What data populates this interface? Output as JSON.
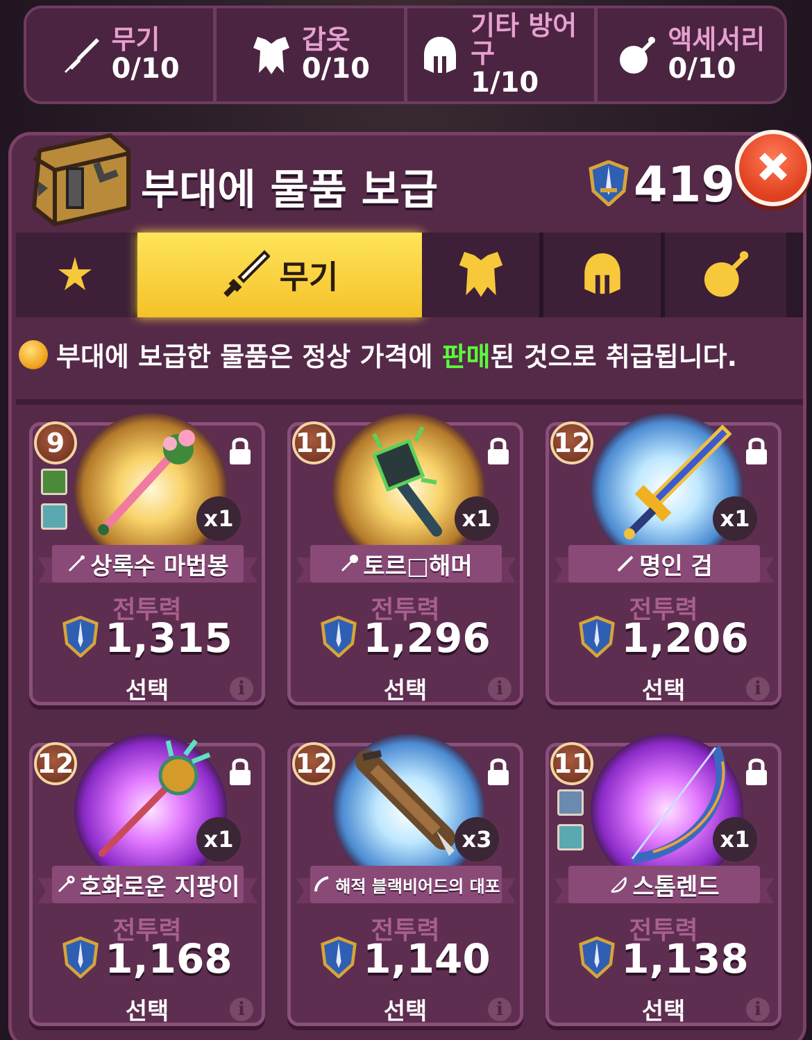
{
  "counters": [
    {
      "label": "무기",
      "value": "0/10",
      "icon": "sword-icon"
    },
    {
      "label": "갑옷",
      "value": "0/10",
      "icon": "armor-icon"
    },
    {
      "label": "기타 방어구",
      "value": "1/10",
      "icon": "helmet-icon"
    },
    {
      "label": "액세서리",
      "value": "0/10",
      "icon": "potion-icon"
    }
  ],
  "header": {
    "title": "부대에 물품 보급",
    "power_total": "419"
  },
  "tabs": [
    {
      "name": "favorites",
      "label": "",
      "icon": "star-icon"
    },
    {
      "name": "weapon",
      "label": "무기",
      "icon": "sword-icon",
      "active": true
    },
    {
      "name": "armor",
      "label": "",
      "icon": "armor-icon"
    },
    {
      "name": "helmet",
      "label": "",
      "icon": "helmet-icon"
    },
    {
      "name": "accessory",
      "label": "",
      "icon": "potion-icon"
    }
  ],
  "notice": {
    "prefix": "부대에 보급한 물품은 정상 가격에 ",
    "highlight": "판매",
    "suffix": "된 것으로 취급됩니다."
  },
  "cards": [
    {
      "level": "9",
      "qty": "x1",
      "name": "상록수 마법봉",
      "combat_label": "전투력",
      "power": "1,315",
      "select": "선택",
      "glow": "gold",
      "weapon_type": "wand-icon",
      "traits": [
        "leaf-icon",
        "wolf-icon"
      ]
    },
    {
      "level": "11",
      "qty": "x1",
      "name": "토르□해머",
      "combat_label": "전투력",
      "power": "1,296",
      "select": "선택",
      "glow": "gold",
      "weapon_type": "mace-icon",
      "traits": []
    },
    {
      "level": "12",
      "qty": "x1",
      "name": "명인 검",
      "combat_label": "전투력",
      "power": "1,206",
      "select": "선택",
      "glow": "blue",
      "weapon_type": "sword-icon",
      "traits": []
    },
    {
      "level": "12",
      "qty": "x1",
      "name": "호화로운 지팡이",
      "combat_label": "전투력",
      "power": "1,168",
      "select": "선택",
      "glow": "purple",
      "weapon_type": "staff-icon",
      "traits": []
    },
    {
      "level": "12",
      "qty": "x3",
      "name": "해적 블랙비어드의 대포",
      "combat_label": "전투력",
      "power": "1,140",
      "select": "선택",
      "glow": "blue",
      "weapon_type": "gun-icon",
      "traits": []
    },
    {
      "level": "11",
      "qty": "x1",
      "name": "스톰렌드",
      "combat_label": "전투력",
      "power": "1,138",
      "select": "선택",
      "glow": "purple",
      "weapon_type": "bow-icon",
      "traits": [
        "swirl-icon",
        "wolf-icon"
      ]
    }
  ],
  "colors": {
    "accent": "#f4c22a",
    "panel": "#552948",
    "highlight": "#5aff3c",
    "close": "#e0401e"
  }
}
